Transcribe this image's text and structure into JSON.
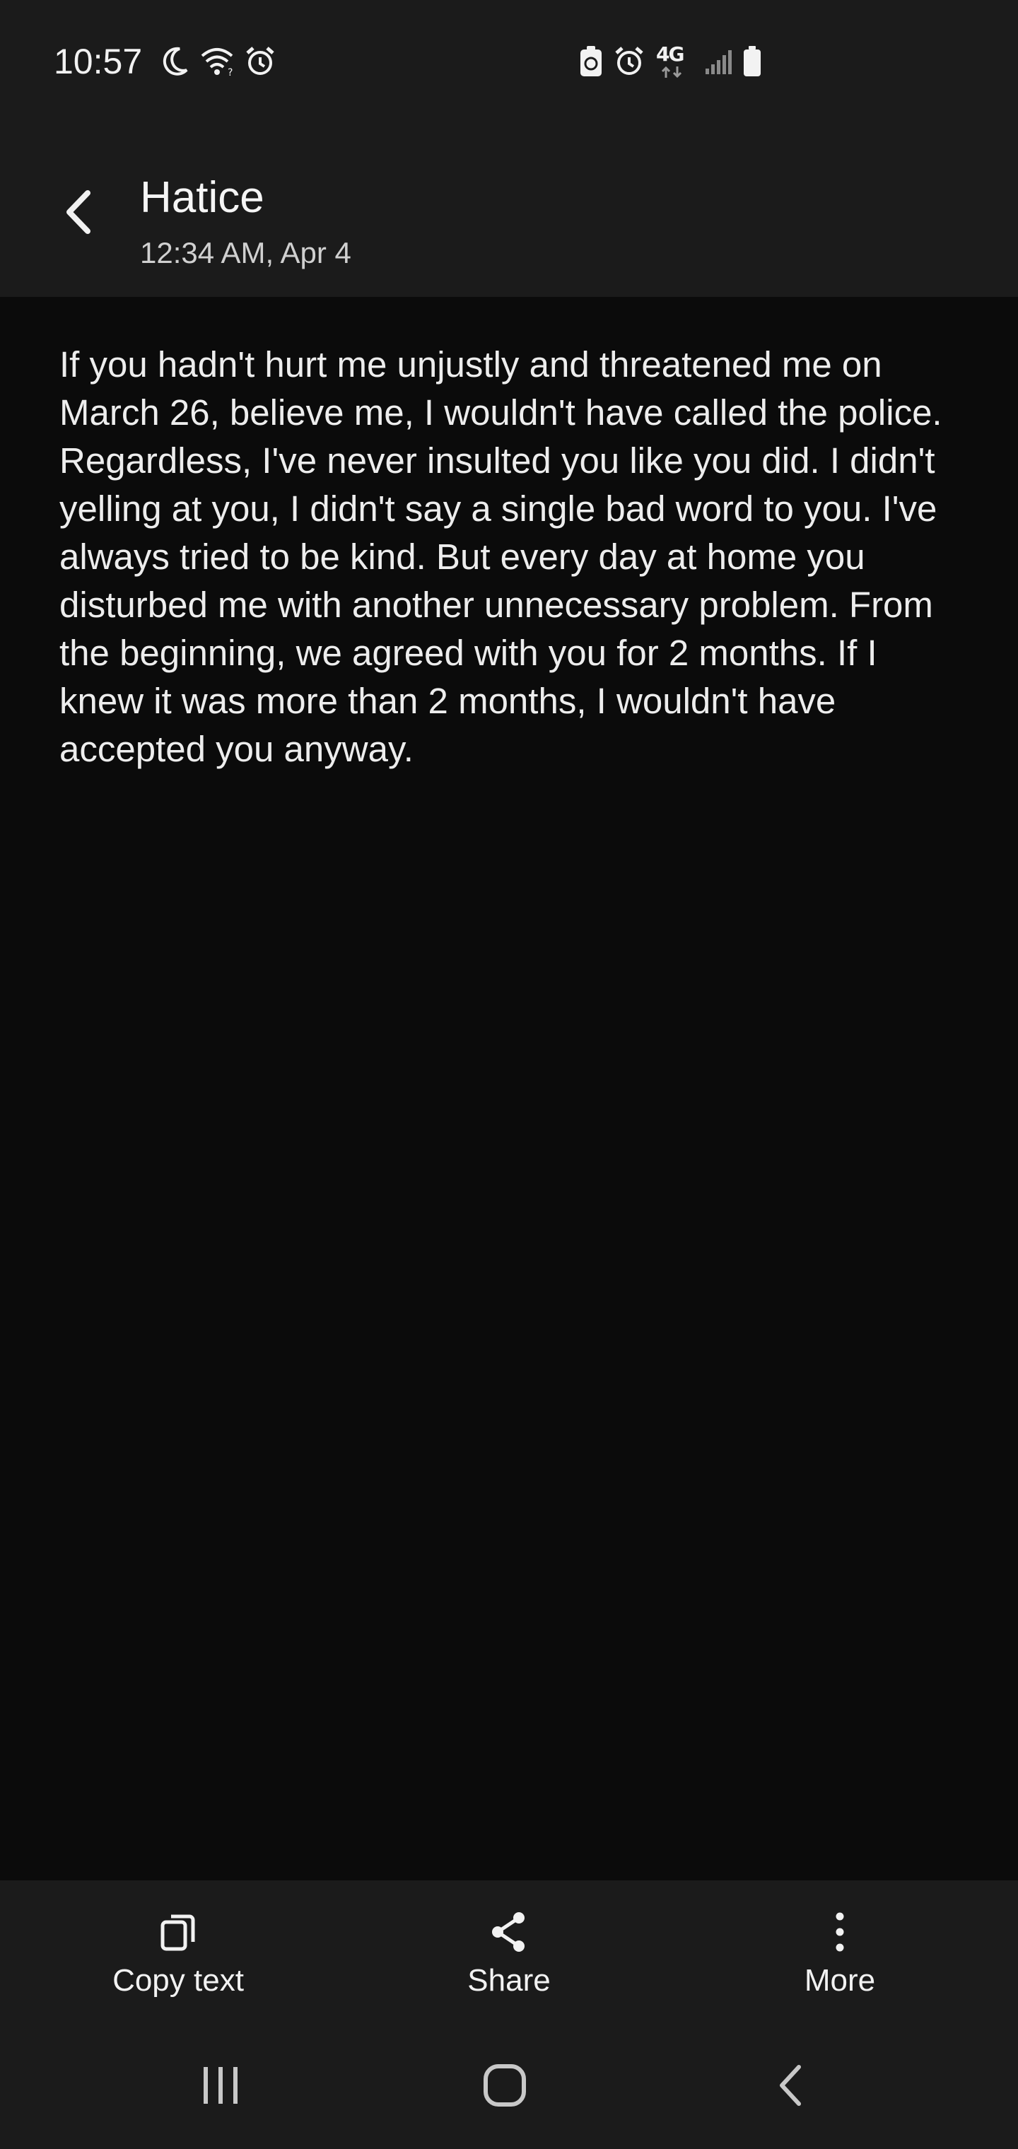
{
  "status_bar": {
    "time": "10:57",
    "network": "4G",
    "left_icons": [
      "moon-icon",
      "wifi-icon",
      "alarm-icon"
    ],
    "right_icons": [
      "recycle-icon",
      "alarm-icon",
      "4g-icon",
      "signal-icon",
      "battery-icon"
    ]
  },
  "header": {
    "back_icon": "chevron-left-icon",
    "title": "Hatice",
    "subtitle": "12:34 AM, Apr 4"
  },
  "message": {
    "text": "If you hadn't hurt me unjustly and threatened me on March 26, believe me, I wouldn't have called the police.  Regardless, I've never insulted you like you did.  I didn't yelling at you, I didn't say a single bad word to you.  I've always tried to be kind.  But every day at home you disturbed me with another unnecessary problem.  From the beginning, we agreed with you for 2 months.  If I knew it was more than 2 months, I wouldn't have accepted you anyway."
  },
  "actions": [
    {
      "icon": "copy-icon",
      "label": "Copy text"
    },
    {
      "icon": "share-icon",
      "label": "Share"
    },
    {
      "icon": "more-vertical-icon",
      "label": "More"
    }
  ],
  "nav_bar": {
    "buttons": [
      "recent-apps-icon",
      "home-icon",
      "back-icon"
    ]
  },
  "colors": {
    "background": "#0b0b0b",
    "bars": "#1b1b1b",
    "text": "#f2f2f2",
    "secondary_text": "#d0d0d0"
  }
}
